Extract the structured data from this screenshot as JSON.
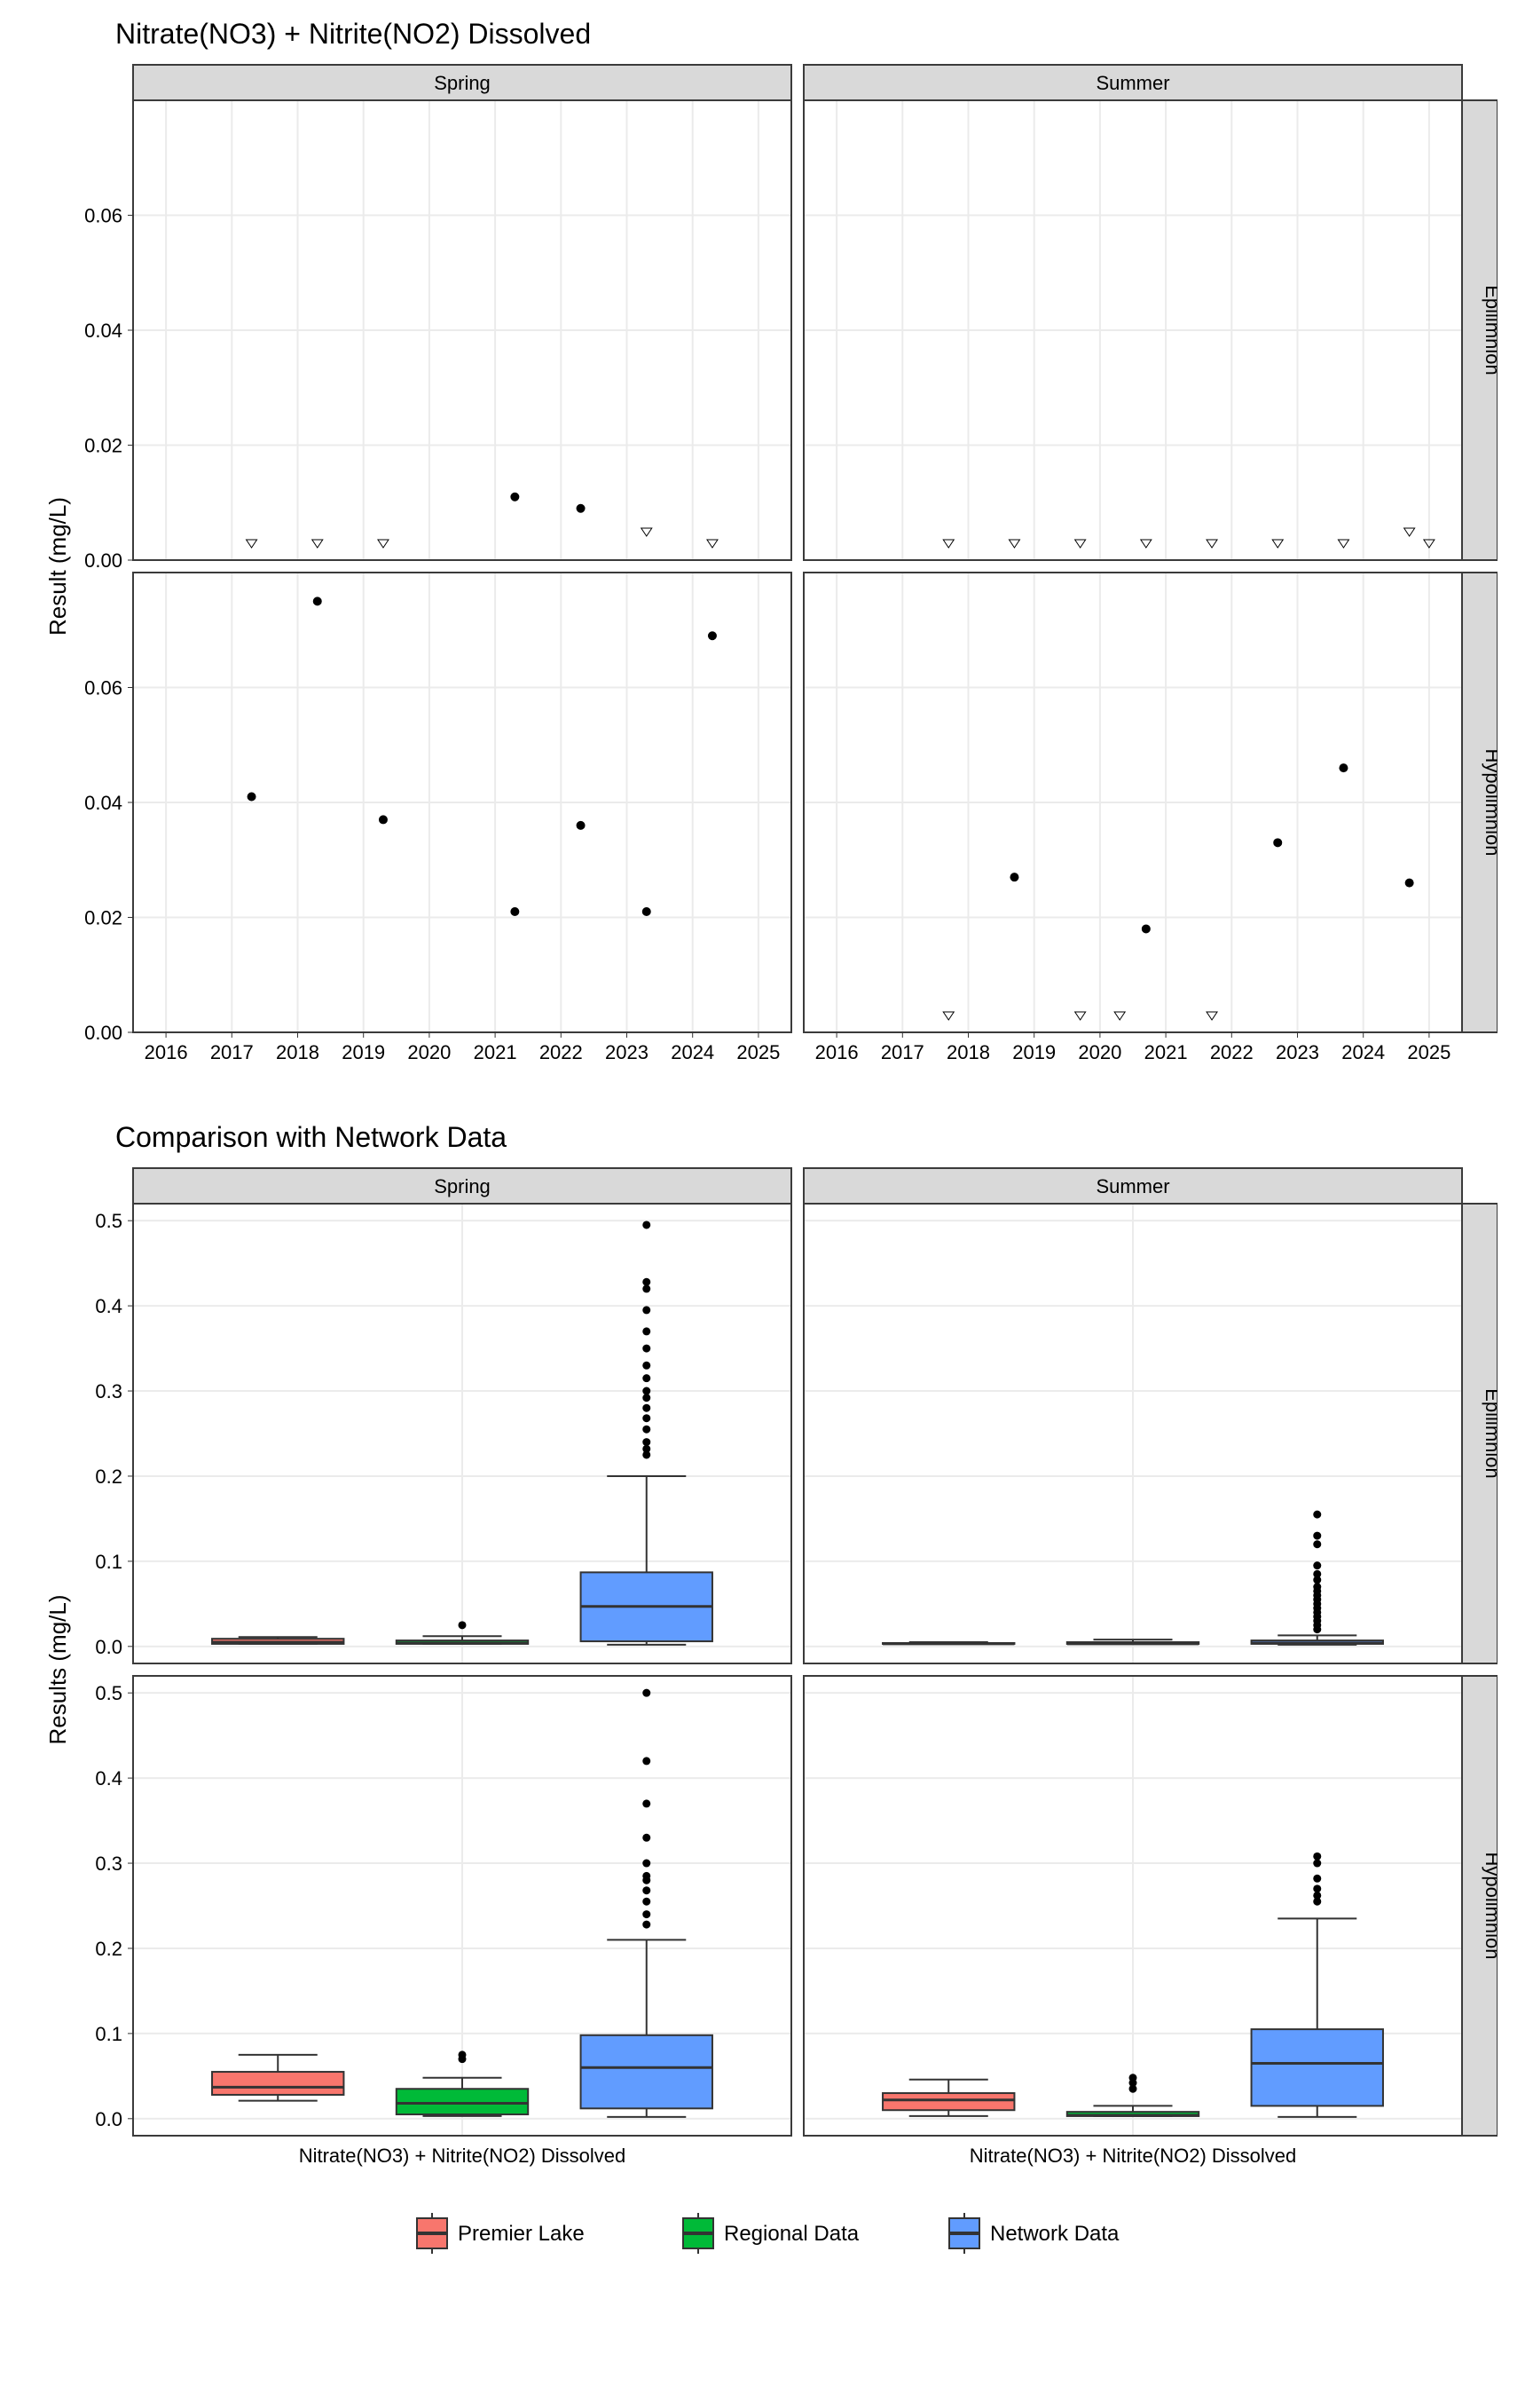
{
  "chart_data": [
    {
      "id": "scatter",
      "title": "Nitrate(NO3) + Nitrite(NO2) Dissolved",
      "ylabel": "Result (mg/L)",
      "y_range": [
        0,
        0.08
      ],
      "y_ticks": [
        0.0,
        0.02,
        0.04,
        0.06
      ],
      "x_range": [
        2015.5,
        2025.5
      ],
      "x_ticks": [
        2016,
        2017,
        2018,
        2019,
        2020,
        2021,
        2022,
        2023,
        2024,
        2025
      ],
      "cols": [
        "Spring",
        "Summer"
      ],
      "rows": [
        "Epilimnion",
        "Hypolimnion"
      ],
      "panels": {
        "Spring|Epilimnion": {
          "filled": [
            {
              "x": 2021.3,
              "y": 0.011
            },
            {
              "x": 2022.3,
              "y": 0.009
            }
          ],
          "open": [
            {
              "x": 2017.3,
              "y": 0.003
            },
            {
              "x": 2018.3,
              "y": 0.003
            },
            {
              "x": 2019.3,
              "y": 0.003
            },
            {
              "x": 2023.3,
              "y": 0.005
            },
            {
              "x": 2024.3,
              "y": 0.003
            }
          ]
        },
        "Summer|Epilimnion": {
          "filled": [],
          "open": [
            {
              "x": 2017.7,
              "y": 0.003
            },
            {
              "x": 2018.7,
              "y": 0.003
            },
            {
              "x": 2019.7,
              "y": 0.003
            },
            {
              "x": 2020.7,
              "y": 0.003
            },
            {
              "x": 2021.7,
              "y": 0.003
            },
            {
              "x": 2022.7,
              "y": 0.003
            },
            {
              "x": 2023.7,
              "y": 0.003
            },
            {
              "x": 2024.7,
              "y": 0.005
            },
            {
              "x": 2025.0,
              "y": 0.003
            }
          ]
        },
        "Spring|Hypolimnion": {
          "filled": [
            {
              "x": 2017.3,
              "y": 0.041
            },
            {
              "x": 2018.3,
              "y": 0.075
            },
            {
              "x": 2019.3,
              "y": 0.037
            },
            {
              "x": 2021.3,
              "y": 0.021
            },
            {
              "x": 2022.3,
              "y": 0.036
            },
            {
              "x": 2023.3,
              "y": 0.021
            },
            {
              "x": 2024.3,
              "y": 0.069
            }
          ],
          "open": []
        },
        "Summer|Hypolimnion": {
          "filled": [
            {
              "x": 2018.7,
              "y": 0.027
            },
            {
              "x": 2020.7,
              "y": 0.018
            },
            {
              "x": 2022.7,
              "y": 0.033
            },
            {
              "x": 2023.7,
              "y": 0.046
            },
            {
              "x": 2024.7,
              "y": 0.026
            }
          ],
          "open": [
            {
              "x": 2017.7,
              "y": 0.003
            },
            {
              "x": 2019.7,
              "y": 0.003
            },
            {
              "x": 2020.3,
              "y": 0.003
            },
            {
              "x": 2021.7,
              "y": 0.003
            }
          ]
        }
      }
    },
    {
      "id": "box",
      "title": "Comparison with Network Data",
      "ylabel": "Results (mg/L)",
      "xlabel": "Nitrate(NO3) + Nitrite(NO2) Dissolved",
      "y_range": [
        -0.02,
        0.52
      ],
      "y_ticks": [
        0.0,
        0.1,
        0.2,
        0.3,
        0.4,
        0.5
      ],
      "cols": [
        "Spring",
        "Summer"
      ],
      "rows": [
        "Epilimnion",
        "Hypolimnion"
      ],
      "series": [
        {
          "name": "Premier Lake",
          "color": "#f8766d"
        },
        {
          "name": "Regional Data",
          "color": "#00ba38"
        },
        {
          "name": "Network Data",
          "color": "#619cff"
        }
      ],
      "panels": {
        "Spring|Epilimnion": [
          {
            "series": "Premier Lake",
            "min": 0.003,
            "q1": 0.003,
            "med": 0.005,
            "q3": 0.009,
            "max": 0.011,
            "out": []
          },
          {
            "series": "Regional Data",
            "min": 0.003,
            "q1": 0.003,
            "med": 0.004,
            "q3": 0.007,
            "max": 0.012,
            "out": [
              0.025
            ]
          },
          {
            "series": "Network Data",
            "min": 0.002,
            "q1": 0.006,
            "med": 0.047,
            "q3": 0.087,
            "max": 0.2,
            "out": [
              0.225,
              0.232,
              0.24,
              0.255,
              0.268,
              0.28,
              0.292,
              0.3,
              0.315,
              0.33,
              0.35,
              0.37,
              0.395,
              0.42,
              0.428,
              0.495
            ]
          }
        ],
        "Summer|Epilimnion": [
          {
            "series": "Premier Lake",
            "min": 0.003,
            "q1": 0.003,
            "med": 0.003,
            "q3": 0.004,
            "max": 0.005,
            "out": []
          },
          {
            "series": "Regional Data",
            "min": 0.003,
            "q1": 0.003,
            "med": 0.003,
            "q3": 0.005,
            "max": 0.008,
            "out": []
          },
          {
            "series": "Network Data",
            "min": 0.002,
            "q1": 0.003,
            "med": 0.004,
            "q3": 0.007,
            "max": 0.013,
            "out": [
              0.02,
              0.025,
              0.03,
              0.035,
              0.04,
              0.045,
              0.05,
              0.055,
              0.06,
              0.065,
              0.07,
              0.078,
              0.085,
              0.095,
              0.12,
              0.13,
              0.155
            ]
          }
        ],
        "Spring|Hypolimnion": [
          {
            "series": "Premier Lake",
            "min": 0.021,
            "q1": 0.028,
            "med": 0.037,
            "q3": 0.055,
            "max": 0.075,
            "out": []
          },
          {
            "series": "Regional Data",
            "min": 0.003,
            "q1": 0.005,
            "med": 0.018,
            "q3": 0.035,
            "max": 0.048,
            "out": [
              0.07,
              0.075
            ]
          },
          {
            "series": "Network Data",
            "min": 0.002,
            "q1": 0.012,
            "med": 0.06,
            "q3": 0.098,
            "max": 0.21,
            "out": [
              0.228,
              0.24,
              0.255,
              0.268,
              0.28,
              0.285,
              0.3,
              0.33,
              0.37,
              0.42,
              0.5
            ]
          }
        ],
        "Summer|Hypolimnion": [
          {
            "series": "Premier Lake",
            "min": 0.003,
            "q1": 0.01,
            "med": 0.022,
            "q3": 0.03,
            "max": 0.046,
            "out": []
          },
          {
            "series": "Regional Data",
            "min": 0.003,
            "q1": 0.003,
            "med": 0.004,
            "q3": 0.008,
            "max": 0.015,
            "out": [
              0.035,
              0.042,
              0.048
            ]
          },
          {
            "series": "Network Data",
            "min": 0.002,
            "q1": 0.015,
            "med": 0.065,
            "q3": 0.105,
            "max": 0.235,
            "out": [
              0.255,
              0.262,
              0.27,
              0.282,
              0.3,
              0.308
            ]
          }
        ]
      }
    }
  ],
  "legend": [
    {
      "label": "Premier Lake",
      "color": "#f8766d"
    },
    {
      "label": "Regional Data",
      "color": "#00ba38"
    },
    {
      "label": "Network Data",
      "color": "#619cff"
    }
  ]
}
